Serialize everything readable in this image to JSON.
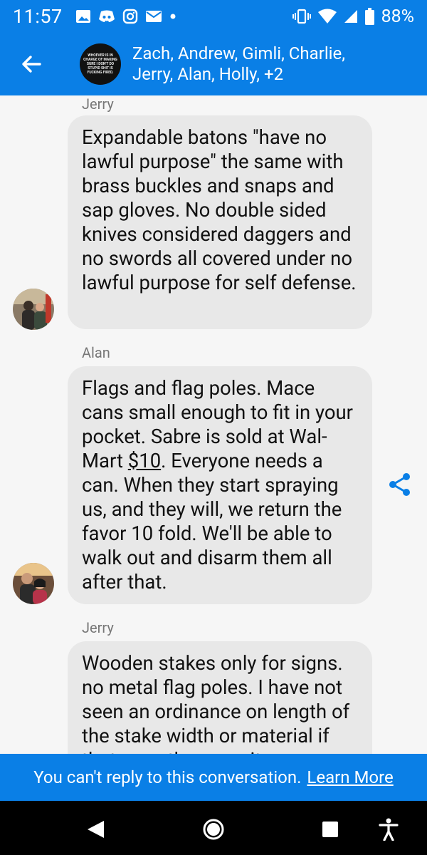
{
  "status_bar": {
    "time": "11:57",
    "battery": "88%",
    "left_icons": [
      "image-icon",
      "discord-icon",
      "instagram-icon",
      "mail-icon",
      "dot-icon"
    ],
    "right_icons": [
      "vibrate-icon",
      "wifi-icon",
      "signal-icon",
      "battery-icon"
    ]
  },
  "header": {
    "title": "Zach, Andrew, Gimli, Charlie, Jerry, Alan, Holly, +2",
    "avatar_text": "Whoever is in charge of making sure I don't do stupid shit is fucking fired."
  },
  "messages": [
    {
      "sender": "Jerry",
      "text": "Expandable batons \"have no lawful purpose\" the same with brass buckles and snaps and sap gloves. No double sided knives considered daggers and no swords all covered under no lawful purpose for self defense."
    },
    {
      "sender": "Alan",
      "text_before": "Flags and flag poles. Mace cans small enough to fit in your pocket. Sabre is sold at Wal-Mart ",
      "text_link": "$10",
      "text_after": ". Everyone needs a can. When they start spraying us, and they will, we return the favor 10 fold. We'll be able to walk out and disarm them all after that."
    },
    {
      "sender": "Jerry",
      "text": "Wooden stakes only for signs. no metal flag poles. I have not seen an ordinance on length of the stake width or material if that were the case, it"
    }
  ],
  "footer": {
    "notice": "You can't reply to this conversation.",
    "link": "Learn More"
  },
  "colors": {
    "brand_blue": "#0a7fe6",
    "bubble_gray": "#e8e8e8",
    "background": "#f6f6f6"
  }
}
